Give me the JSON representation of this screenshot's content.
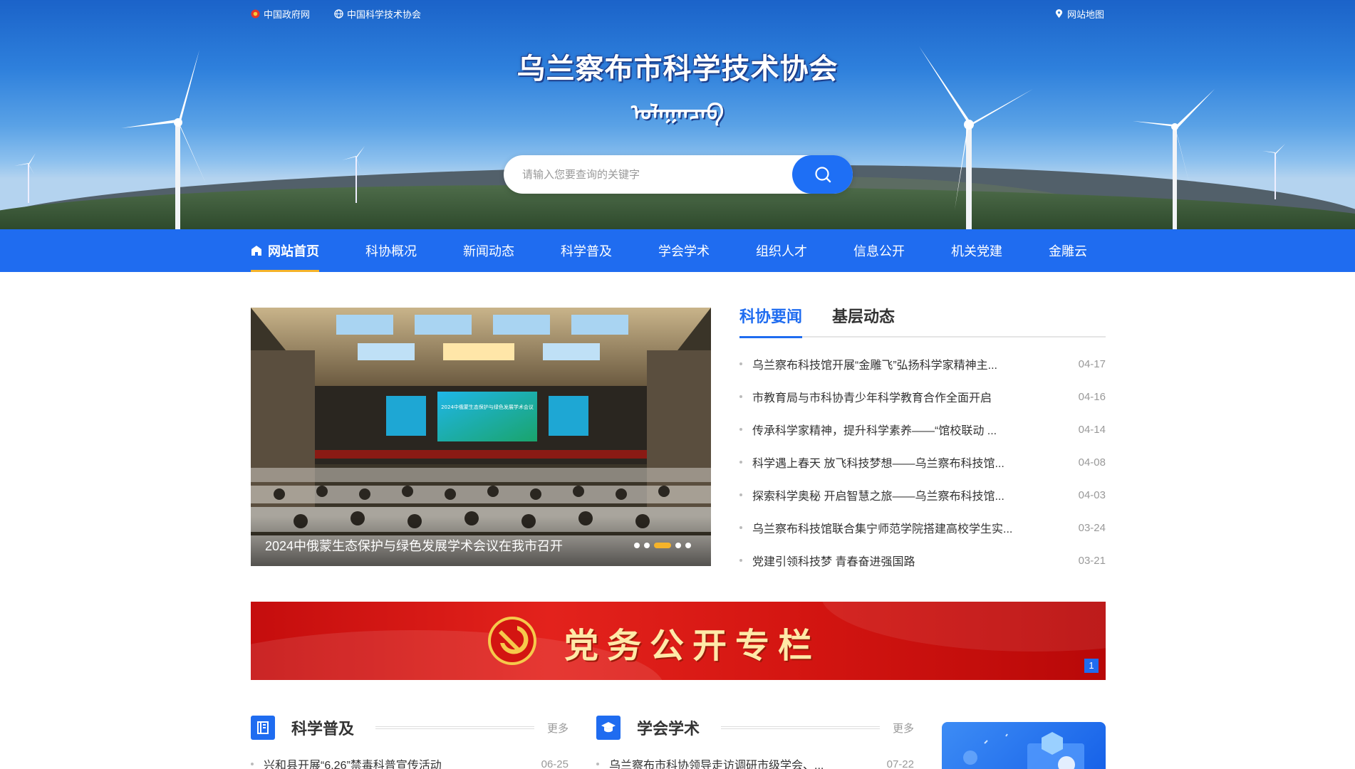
{
  "top_links": {
    "gov_label": "中国政府网",
    "cast_label": "中国科学技术协会",
    "sitemap_label": "网站地图"
  },
  "header": {
    "title": "乌兰察布市科学技术协会",
    "subtitle": "ᠤᠯᠠᠭᠠᠨᠴᠠᠪ"
  },
  "search": {
    "placeholder": "请输入您要查询的关键字"
  },
  "nav": {
    "items": [
      {
        "label": "网站首页"
      },
      {
        "label": "科协概况"
      },
      {
        "label": "新闻动态"
      },
      {
        "label": "科学普及"
      },
      {
        "label": "学会学术"
      },
      {
        "label": "组织人才"
      },
      {
        "label": "信息公开"
      },
      {
        "label": "机关党建"
      },
      {
        "label": "金雕云"
      }
    ]
  },
  "slider": {
    "caption": "2024中俄蒙生态保护与绿色发展学术会议在我市召开",
    "screen_text": "2024中俄蒙生态保护与绿色发展学术会议",
    "active_index": 2
  },
  "news": {
    "tabs": [
      {
        "label": "科协要闻"
      },
      {
        "label": "基层动态"
      }
    ],
    "items": [
      {
        "title": "乌兰察布科技馆开展“金雕飞”弘扬科学家精神主...",
        "date": "04-17"
      },
      {
        "title": "市教育局与市科协青少年科学教育合作全面开启",
        "date": "04-16"
      },
      {
        "title": "传承科学家精神，提升科学素养——“馆校联动 ...",
        "date": "04-14"
      },
      {
        "title": "科学遇上春天 放飞科技梦想——乌兰察布科技馆...",
        "date": "04-08"
      },
      {
        "title": "探索科学奥秘 开启智慧之旅——乌兰察布科技馆...",
        "date": "04-03"
      },
      {
        "title": "乌兰察布科技馆联合集宁师范学院搭建高校学生实...",
        "date": "03-24"
      },
      {
        "title": "党建引领科技梦 青春奋进强国路",
        "date": "03-21"
      }
    ]
  },
  "banner": {
    "title": "党务公开专栏",
    "page": "1"
  },
  "sections": [
    {
      "name": "科学普及",
      "more": "更多",
      "items": [
        {
          "title": "兴和县开展“6.26”禁毒科普宣传活动",
          "date": "06-25"
        }
      ]
    },
    {
      "name": "学会学术",
      "more": "更多",
      "items": [
        {
          "title": "乌兰察布市科协领导走访调研市级学会、...",
          "date": "07-22"
        }
      ]
    }
  ],
  "colors": {
    "primary": "#1f6cf0",
    "accent": "#f5b32a",
    "banner_red": "#d31511"
  },
  "icons": {
    "gov": "gov-emblem-icon",
    "cast": "globe-icon",
    "sitemap": "location-pin-icon",
    "search": "search-icon",
    "home": "home-icon",
    "book": "book-icon",
    "cap": "graduation-cap-icon"
  }
}
